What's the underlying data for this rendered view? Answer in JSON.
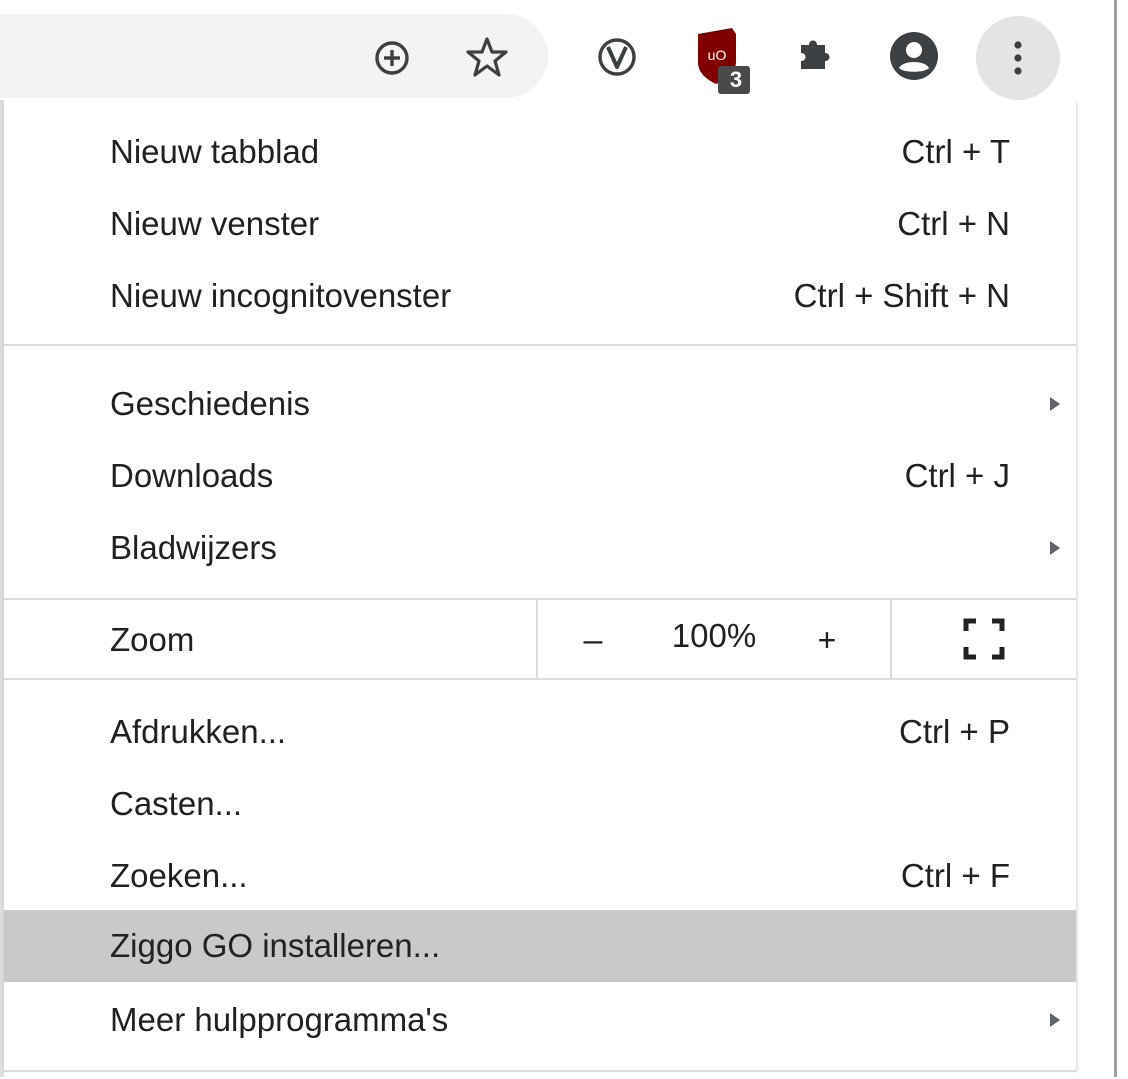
{
  "toolbar": {
    "icons": [
      "add-circle-icon",
      "star-icon",
      "vivaldi-v-icon",
      "ublock-shield-icon",
      "puzzle-extensions-icon",
      "account-icon",
      "more-vertical-icon"
    ],
    "ublock_badge": "3"
  },
  "menu": {
    "group1": [
      {
        "label": "Nieuw tabblad",
        "shortcut": "Ctrl + T"
      },
      {
        "label": "Nieuw venster",
        "shortcut": "Ctrl + N"
      },
      {
        "label": "Nieuw incognitovenster",
        "shortcut": "Ctrl + Shift + N"
      }
    ],
    "group2": [
      {
        "label": "Geschiedenis",
        "submenu": true
      },
      {
        "label": "Downloads",
        "shortcut": "Ctrl + J"
      },
      {
        "label": "Bladwijzers",
        "submenu": true
      }
    ],
    "zoom": {
      "label": "Zoom",
      "minus": "–",
      "level": "100%",
      "plus": "+"
    },
    "group3": [
      {
        "label": "Afdrukken...",
        "shortcut": "Ctrl + P"
      },
      {
        "label": "Casten..."
      },
      {
        "label": "Zoeken...",
        "shortcut": "Ctrl + F"
      },
      {
        "label": "Ziggo GO installeren...",
        "highlighted": true
      },
      {
        "label": "Meer hulpprogramma's",
        "submenu": true
      }
    ]
  },
  "colors": {
    "highlight": "#c9c9c9",
    "ublock_red": "#800000",
    "icon_gray": "#3c4043"
  }
}
